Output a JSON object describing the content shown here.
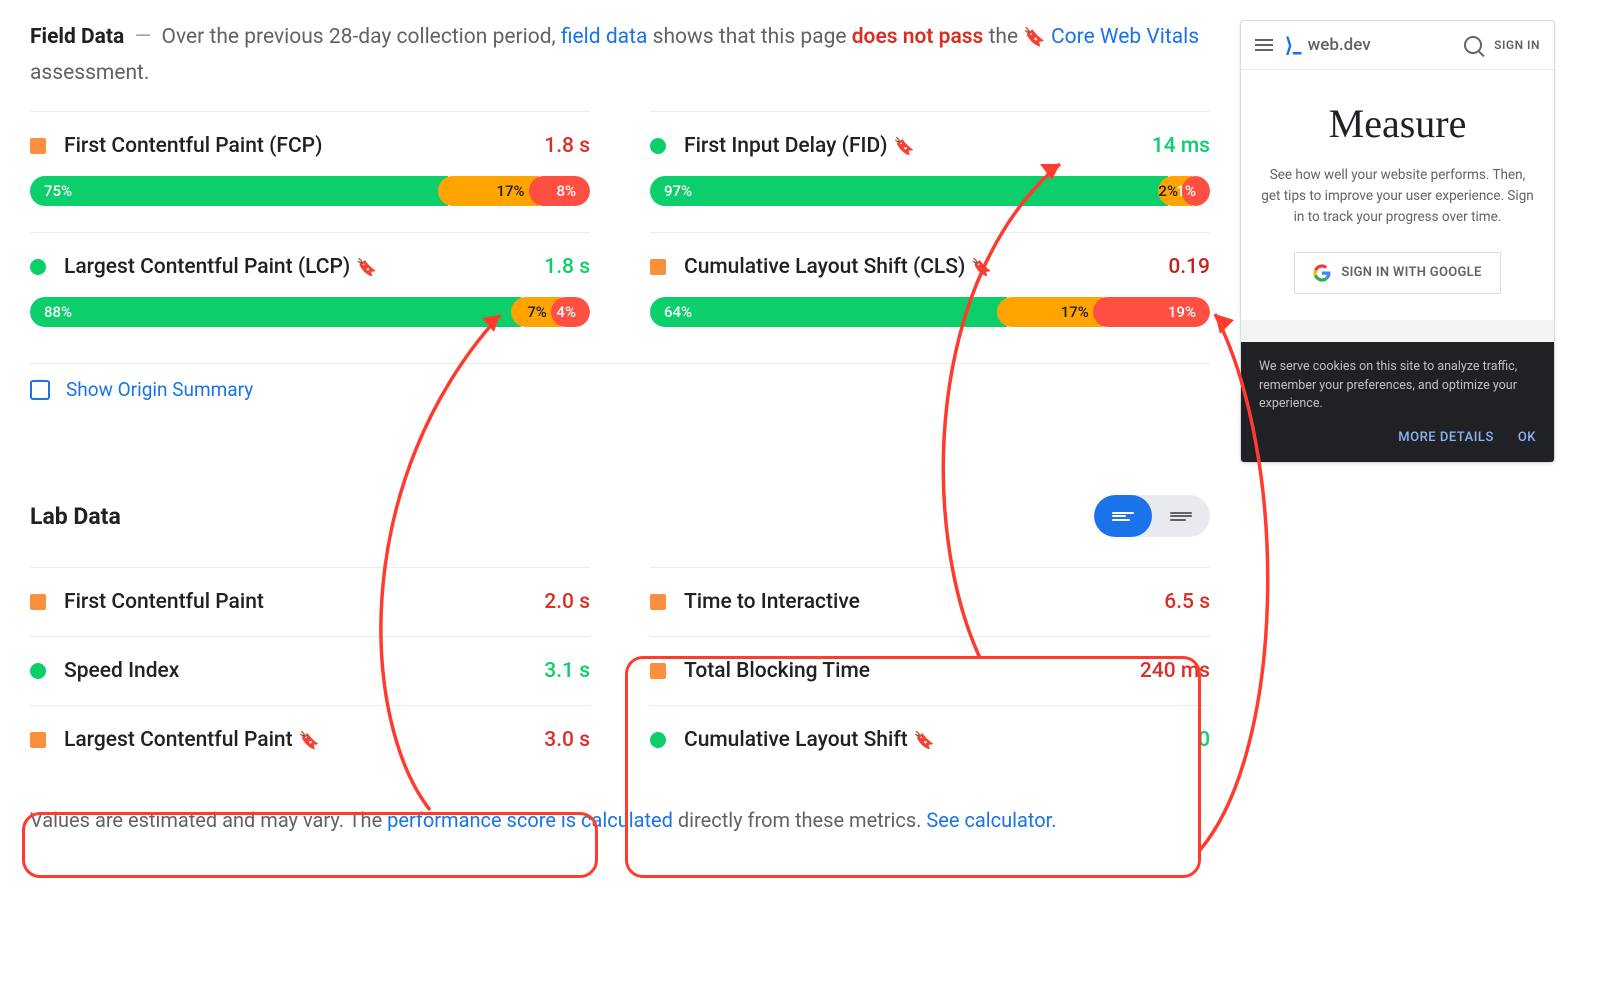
{
  "intro": {
    "head": "Field Data",
    "dash": "—",
    "pre": "Over the previous 28-day collection period,",
    "link1": "field data",
    "mid": "shows that this page",
    "fail": "does not pass",
    "after": "the",
    "bm": "🔖",
    "link2": "Core Web Vitals",
    "after2": "assessment."
  },
  "metrics": {
    "fcp": {
      "name": "First Contentful Paint (FCP)",
      "value": "1.8 s",
      "g": "75%",
      "o": "17%",
      "r": "8%"
    },
    "fid": {
      "name": "First Input Delay (FID)",
      "value": "14 ms",
      "g": "97%",
      "o": "2%",
      "r": "1%"
    },
    "lcp": {
      "name": "Largest Contentful Paint (LCP)",
      "value": "1.8 s",
      "g": "88%",
      "o": "7%",
      "r": "4%"
    },
    "cls": {
      "name": "Cumulative Layout Shift (CLS)",
      "value": "0.19",
      "g": "64%",
      "o": "17%",
      "r": "19%"
    }
  },
  "showOrigin": "Show Origin Summary",
  "labHead": "Lab Data",
  "lab": {
    "fcp": {
      "name": "First Contentful Paint",
      "value": "2.0 s"
    },
    "tti": {
      "name": "Time to Interactive",
      "value": "6.5 s"
    },
    "si": {
      "name": "Speed Index",
      "value": "3.1 s"
    },
    "tbt": {
      "name": "Total Blocking Time",
      "value": "240 ms"
    },
    "lcp": {
      "name": "Largest Contentful Paint",
      "value": "3.0 s"
    },
    "cls": {
      "name": "Cumulative Layout Shift",
      "value": "0"
    }
  },
  "footnote": {
    "pre": "Values are estimated and may vary. The",
    "link1": "performance score is calculated",
    "mid": "directly from these metrics.",
    "link2": "See calculator."
  },
  "phone": {
    "brand": "web.dev",
    "signin": "SIGN IN",
    "title": "Measure",
    "body": "See how well your website performs. Then, get tips to improve your user experience. Sign in to track your progress over time.",
    "btn": "SIGN IN WITH GOOGLE",
    "cookie": "We serve cookies on this site to analyze traffic, remember your preferences, and optimize your experience.",
    "more": "MORE DETAILS",
    "ok": "OK"
  }
}
